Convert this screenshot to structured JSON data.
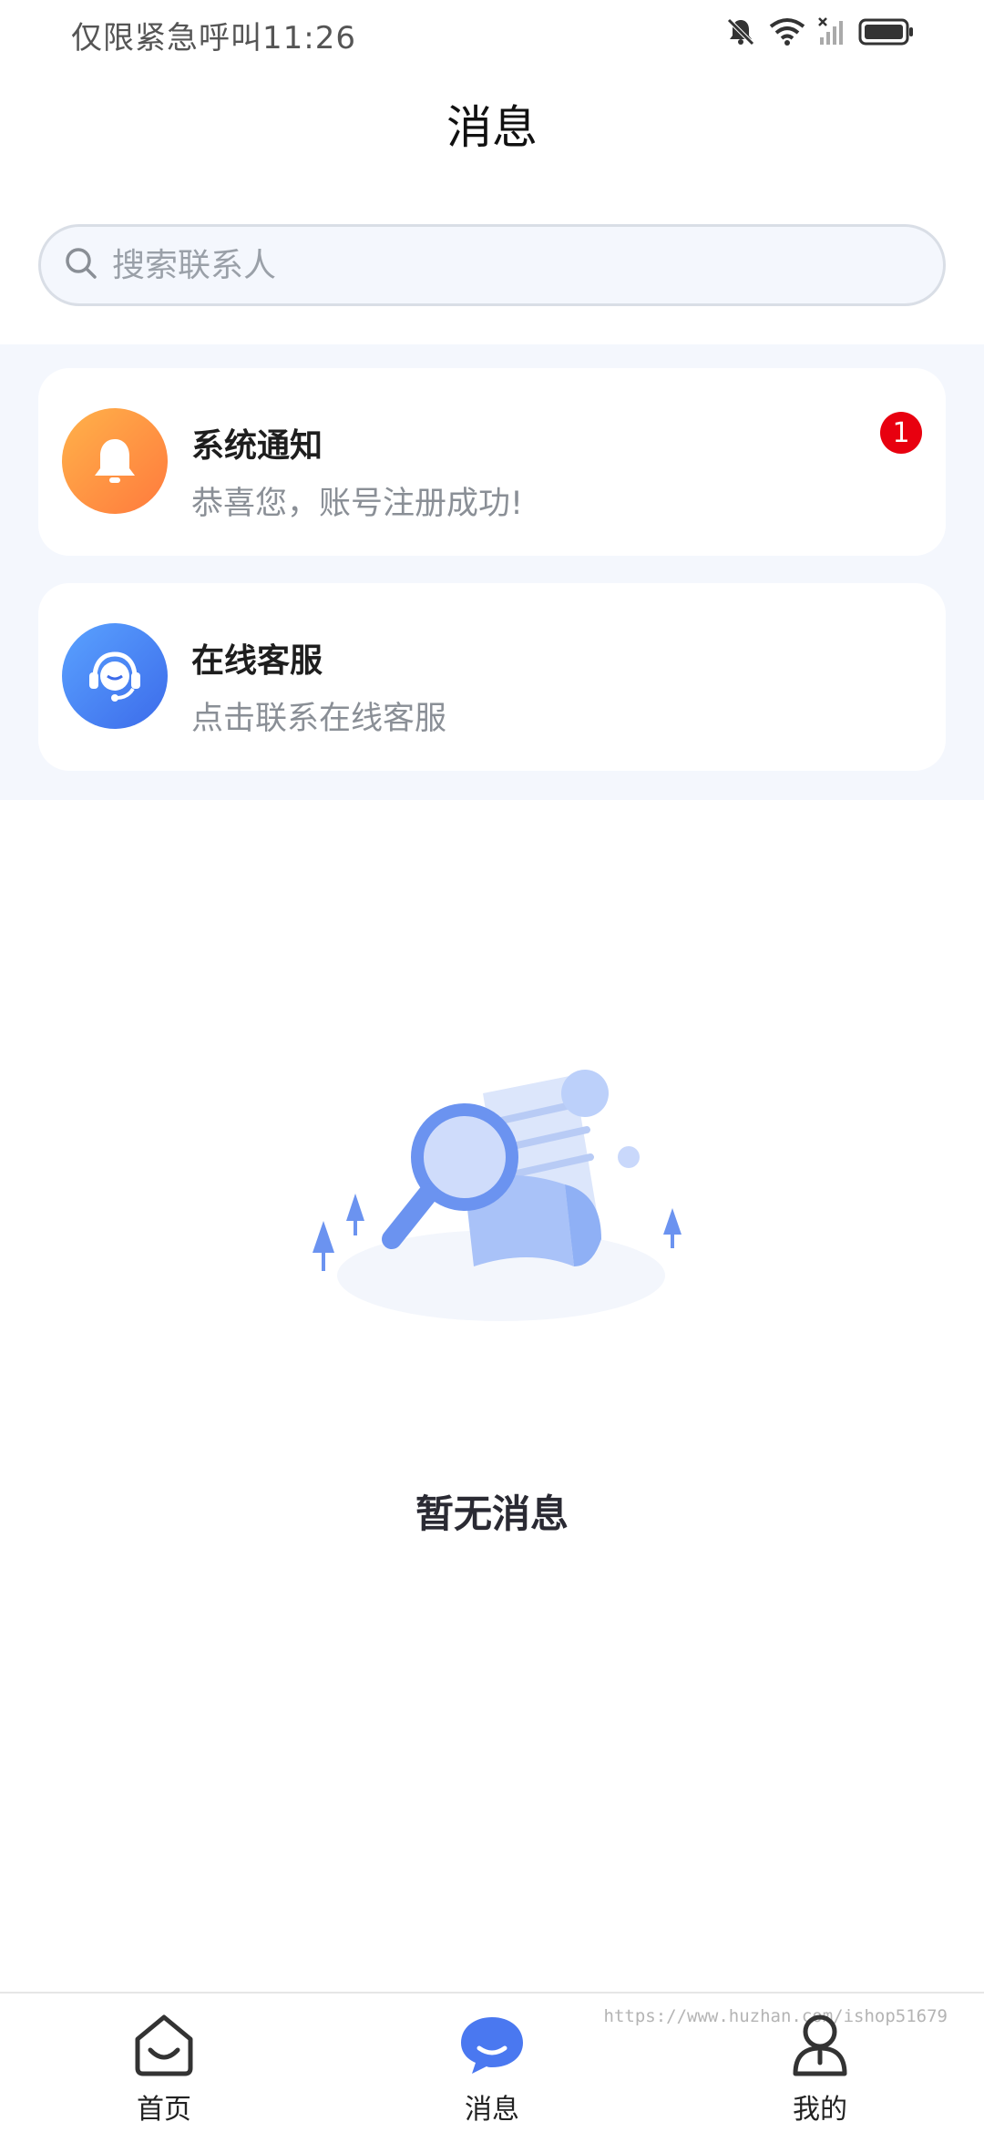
{
  "status_bar": {
    "carrier_text": "仅限紧急呼叫",
    "time": "11:26",
    "icons": [
      "bell-muted-icon",
      "wifi-icon",
      "signal-icon",
      "battery-icon"
    ]
  },
  "header": {
    "title": "消息"
  },
  "search": {
    "placeholder": "搜索联系人",
    "value": ""
  },
  "conversations": [
    {
      "title": "系统通知",
      "subtitle": "恭喜您，账号注册成功!",
      "icon": "bell-icon",
      "badge": "1",
      "icon_color_start": "#ffb24a",
      "icon_color_end": "#ff7a3d"
    },
    {
      "title": "在线客服",
      "subtitle": "点击联系在线客服",
      "icon": "headset-icon",
      "badge": "",
      "icon_color_start": "#5aa2ff",
      "icon_color_end": "#3c6bea"
    }
  ],
  "empty_state": {
    "text": "暂无消息",
    "illustration": "magnifier-document-icon"
  },
  "bottom_nav": {
    "items": [
      {
        "label": "首页",
        "icon": "home-icon",
        "active": false
      },
      {
        "label": "消息",
        "icon": "chat-bubble-icon",
        "active": true
      },
      {
        "label": "我的",
        "icon": "person-icon",
        "active": false
      }
    ],
    "watermark": "https://www.huzhan.com/ishop51679"
  },
  "colors": {
    "accent": "#4a78f0",
    "badge": "#e8000f",
    "section_bg": "#f4f7fd"
  }
}
